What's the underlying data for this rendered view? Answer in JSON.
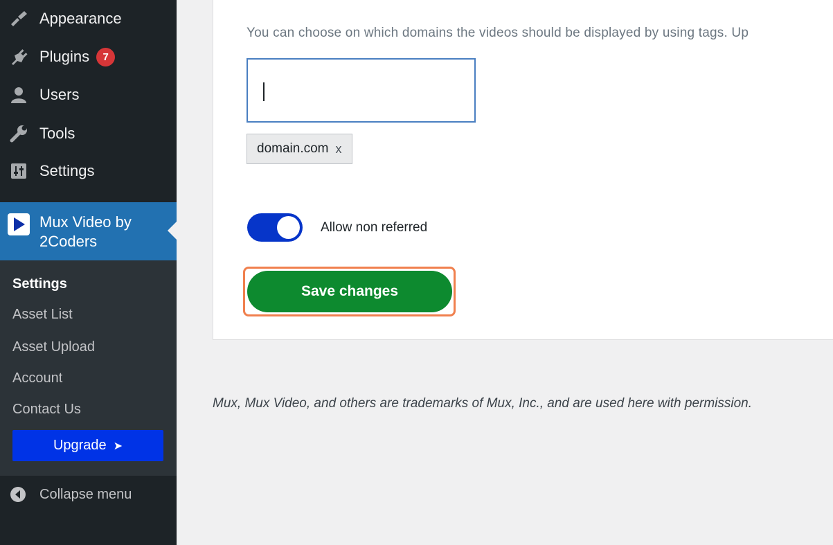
{
  "sidebar": {
    "items": [
      {
        "label": "Appearance",
        "icon": "paintbrush-icon"
      },
      {
        "label": "Plugins",
        "icon": "plugin-icon",
        "badge": "7"
      },
      {
        "label": "Users",
        "icon": "user-icon"
      },
      {
        "label": "Tools",
        "icon": "wrench-icon"
      },
      {
        "label": "Settings",
        "icon": "settings-sliders-icon"
      }
    ],
    "active": {
      "label": "Mux Video by 2Coders",
      "icon": "play-icon"
    },
    "submenu": [
      "Settings",
      "Asset List",
      "Asset Upload",
      "Account",
      "Contact Us"
    ],
    "upgrade_label": "Upgrade",
    "upgrade_arrow": "➤",
    "collapse_label": "Collapse menu"
  },
  "main": {
    "help_text": "You can choose on which domains the videos should be displayed by using tags. Up",
    "tag_input_value": "",
    "tags": [
      {
        "label": "domain.com",
        "remove": "x"
      }
    ],
    "toggle_label": "Allow non referred",
    "toggle_on": true,
    "save_label": "Save changes"
  },
  "footer_text": "Mux, Mux Video, and others are trademarks of Mux, Inc., and are used here with permission.",
  "colors": {
    "sidebar_bg": "#1d2327",
    "active_bg": "#2271b1",
    "badge": "#d63638",
    "upgrade": "#0033e6",
    "toggle": "#0635c9",
    "save": "#0d8a2f",
    "highlight": "#f0804e"
  }
}
